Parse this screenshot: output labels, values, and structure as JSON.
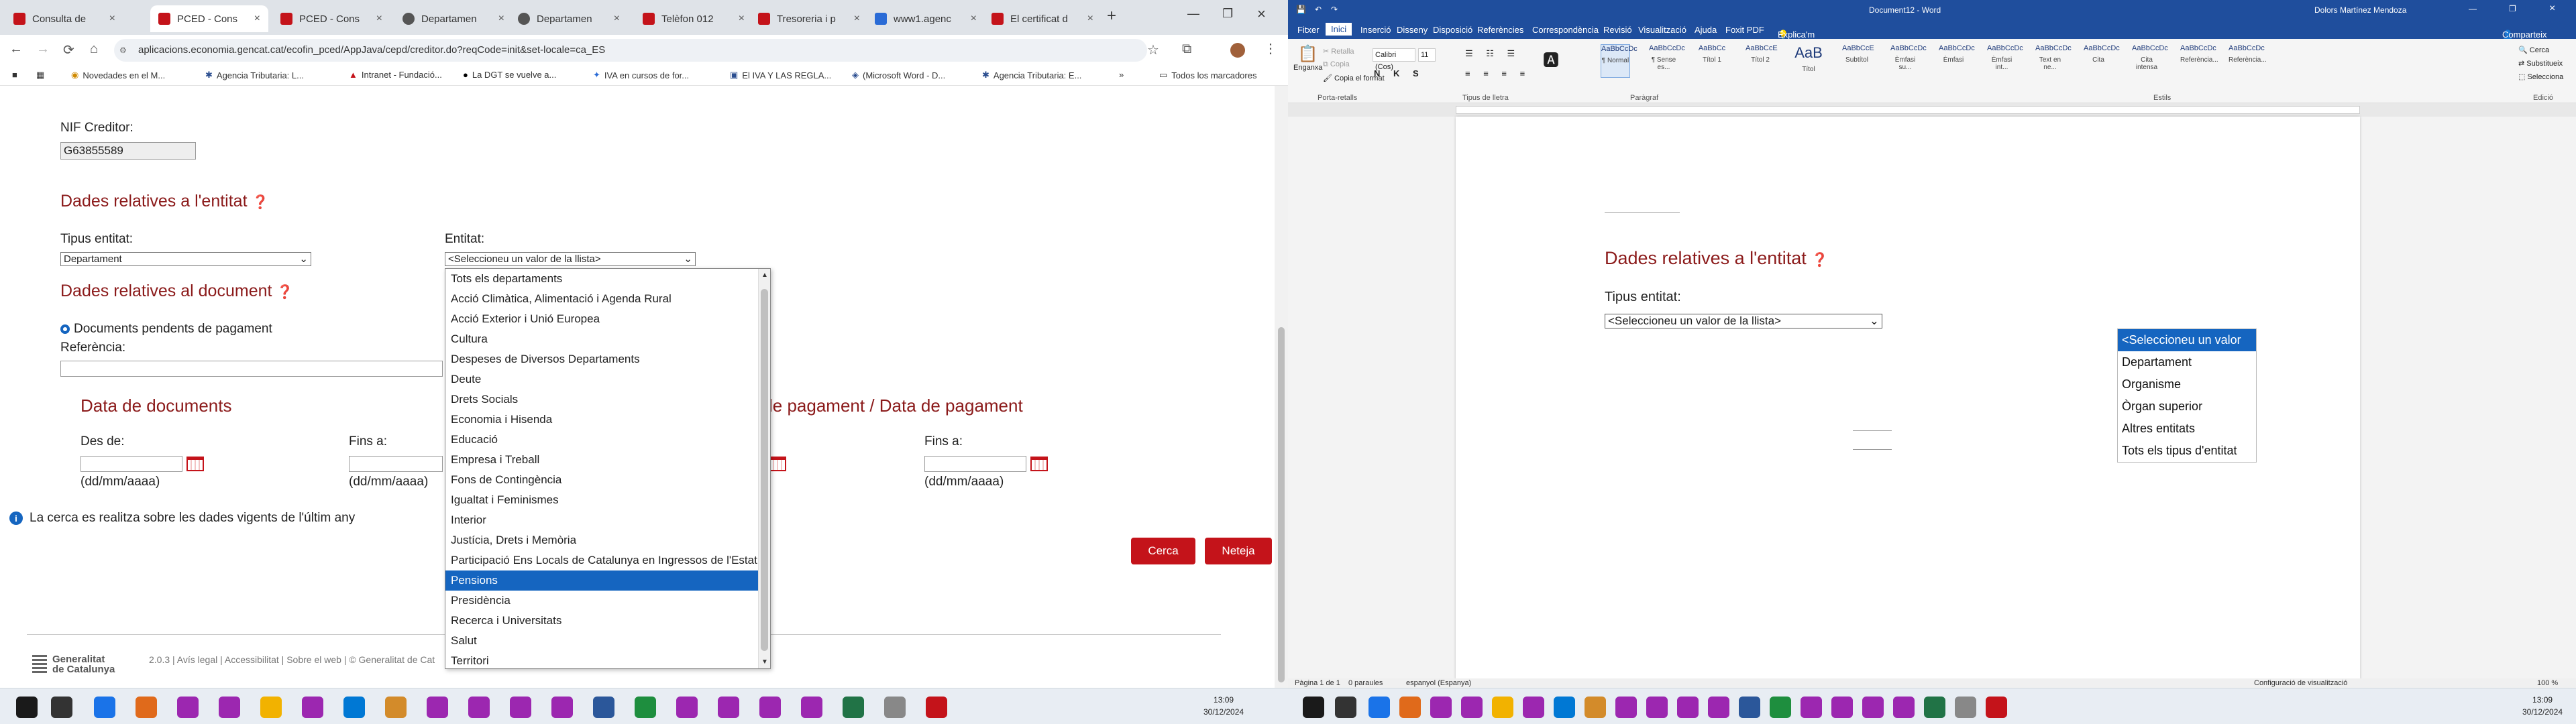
{
  "browser": {
    "tabs": [
      {
        "label": "Consulta de"
      },
      {
        "label": "PCED - Cons"
      },
      {
        "label": "PCED - Cons"
      },
      {
        "label": "Departamen"
      },
      {
        "label": "Departamen"
      },
      {
        "label": "Telèfon 012"
      },
      {
        "label": "Tresoreria i p"
      },
      {
        "label": "www1.agenc"
      },
      {
        "label": "El certificat d"
      }
    ],
    "url": "aplicacions.economia.gencat.cat/ecofin_pced/AppJava/cepd/creditor.do?reqCode=init&set-locale=ca_ES",
    "bookmarks": [
      "Novedades en el M...",
      "Agencia Tributaria: L...",
      "Intranet - Fundació...",
      "La DGT se vuelve a...",
      "IVA en cursos de for...",
      "El IVA Y LAS REGLA...",
      "(Microsoft Word - D...",
      "Agencia Tributaria: E..."
    ],
    "all_bookmarks": "Todos los marcadores"
  },
  "form": {
    "nif_label": "NIF Creditor:",
    "nif_value": "G63855589",
    "entity_section": "Dades relatives a l'entitat",
    "tipus_label": "Tipus entitat:",
    "tipus_value": "Departament",
    "entitat_label": "Entitat:",
    "entitat_value": "<Seleccioneu un valor de la llista>",
    "doc_section": "Dades relatives al document",
    "pending_docs": "Documents pendents de pagament",
    "reference_label": "Referència:",
    "doc_dates": "Data de documents",
    "pay_dates": "le pagament / Data de pagament",
    "from_label": "Des de:",
    "to_label": "Fins a:",
    "to_label2": "Fins a:",
    "date_hint": "(dd/mm/aaaa)",
    "date_hint2": "(dd/mm/aaaa)",
    "date_hint3": "(dd/mm/aaaa)",
    "info": "La cerca es realitza sobre les dades vigents de l'últim any",
    "search_button": "Cerca",
    "clear_button": "Neteja",
    "footer_brand_line1": "Generalitat",
    "footer_brand_line2": "de Catalunya",
    "footer_links": "2.0.3  |  Avís legal  |  Accessibilitat  |  Sobre el web  |  © Generalitat de Cat"
  },
  "entitat_options": [
    "Tots els departaments",
    "Acció Climàtica, Alimentació i Agenda Rural",
    "Acció Exterior i Unió Europea",
    "Cultura",
    "Despeses de Diversos Departaments",
    "Deute",
    "Drets Socials",
    "Economia i Hisenda",
    "Educació",
    "Empresa i Treball",
    "Fons de Contingència",
    "Igualtat i Feminismes",
    "Interior",
    "Justícia, Drets i Memòria",
    "Participació Ens Locals de Catalunya en Ingressos de l'Estat",
    "Pensions",
    "Presidència",
    "Recerca i Universitats",
    "Salut",
    "Territori"
  ],
  "entitat_selected_index": 15,
  "word": {
    "title": "Document12 - Word",
    "user": "Dolors Martínez Mendoza",
    "menu": [
      "Fitxer",
      "Inici",
      "Inserció",
      "Disseny",
      "Disposició",
      "Referències",
      "Correspondència",
      "Revisió",
      "Visualització",
      "Ajuda",
      "Foxit PDF"
    ],
    "tell_me": "Explica'm què vols fer",
    "share": "Comparteix",
    "font_name": "Calibri (Cos)",
    "font_size": "11",
    "paste": "Enganxa",
    "cut": "Retalla",
    "copy": "Copia",
    "format_painter": "Copia el format",
    "styles": [
      {
        "preview": "AaBbCcDc",
        "name": "¶ Normal"
      },
      {
        "preview": "AaBbCcDc",
        "name": "¶ Sense es..."
      },
      {
        "preview": "AaBbCc",
        "name": "Títol 1"
      },
      {
        "preview": "AaBbCcE",
        "name": "Títol 2"
      },
      {
        "preview": "AaB",
        "name": "Títol"
      },
      {
        "preview": "AaBbCcE",
        "name": "Subtítol"
      },
      {
        "preview": "AaBbCcDc",
        "name": "Èmfasi su..."
      },
      {
        "preview": "AaBbCcDc",
        "name": "Èmfasi"
      },
      {
        "preview": "AaBbCcDc",
        "name": "Èmfasi int..."
      },
      {
        "preview": "AaBbCcDc",
        "name": "Text en ne..."
      },
      {
        "preview": "AaBbCcDc",
        "name": "Cita"
      },
      {
        "preview": "AaBbCcDc",
        "name": "Cita intensa"
      },
      {
        "preview": "AaBbCcDc",
        "name": "Referència..."
      },
      {
        "preview": "AaBbCcDc",
        "name": "Referència..."
      }
    ],
    "find": "Cerca",
    "replace": "Substitueix",
    "select": "Selecciona",
    "groups": [
      "Porta-retalls",
      "Tipus de lletra",
      "Paràgraf",
      "Estils",
      "Edició"
    ],
    "doc_heading": "Dades relatives a l'entitat",
    "doc_label": "Tipus entitat:",
    "doc_select": "<Seleccioneu un valor de la llista>",
    "doc_options": [
      "<Seleccioneu un valor de la llista>",
      "Departament",
      "Organisme",
      "Òrgan superior",
      "Altres entitats",
      "Tots els tipus d'entitat"
    ],
    "status_page": "Pàgina 1 de 1",
    "status_words": "0 paraules",
    "status_lang": "espanyol (Espanya)",
    "status_view": "Configuració de visualització",
    "zoom": "100 %"
  },
  "taskbar": {
    "left_time": "13:09",
    "left_date": "30/12/2024",
    "right_time": "13:09",
    "right_date": "30/12/2024"
  },
  "colors": {
    "accent_red": "#c4131a",
    "heading_red": "#8b1a1a",
    "word_blue": "#1f4e9d",
    "select_blue": "#1565c0"
  }
}
